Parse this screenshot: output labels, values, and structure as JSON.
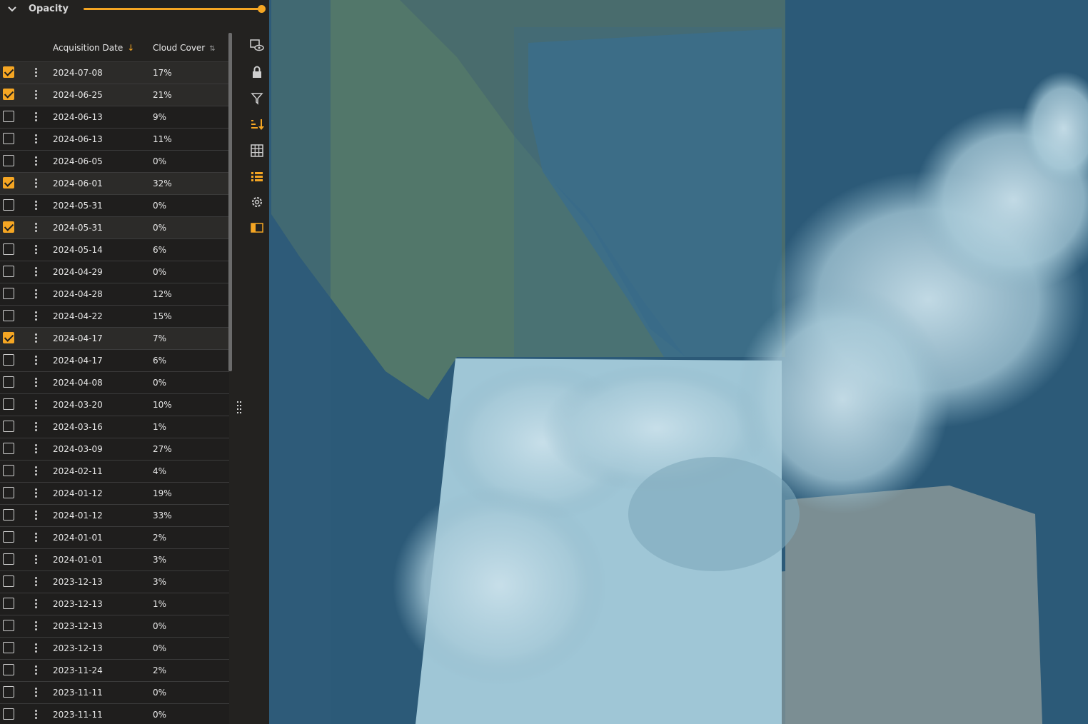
{
  "opacity": {
    "label": "Opacity",
    "value": 1.0
  },
  "table": {
    "columns": {
      "date": "Acquisition Date",
      "cloud": "Cloud Cover"
    },
    "rows": [
      {
        "date": "2024-07-08",
        "cloud": "17%",
        "checked": true
      },
      {
        "date": "2024-06-25",
        "cloud": "21%",
        "checked": true
      },
      {
        "date": "2024-06-13",
        "cloud": "9%",
        "checked": false
      },
      {
        "date": "2024-06-13",
        "cloud": "11%",
        "checked": false
      },
      {
        "date": "2024-06-05",
        "cloud": "0%",
        "checked": false
      },
      {
        "date": "2024-06-01",
        "cloud": "32%",
        "checked": true
      },
      {
        "date": "2024-05-31",
        "cloud": "0%",
        "checked": false
      },
      {
        "date": "2024-05-31",
        "cloud": "0%",
        "checked": true
      },
      {
        "date": "2024-05-14",
        "cloud": "6%",
        "checked": false
      },
      {
        "date": "2024-04-29",
        "cloud": "0%",
        "checked": false
      },
      {
        "date": "2024-04-28",
        "cloud": "12%",
        "checked": false
      },
      {
        "date": "2024-04-22",
        "cloud": "15%",
        "checked": false
      },
      {
        "date": "2024-04-17",
        "cloud": "7%",
        "checked": true
      },
      {
        "date": "2024-04-17",
        "cloud": "6%",
        "checked": false
      },
      {
        "date": "2024-04-08",
        "cloud": "0%",
        "checked": false
      },
      {
        "date": "2024-03-20",
        "cloud": "10%",
        "checked": false
      },
      {
        "date": "2024-03-16",
        "cloud": "1%",
        "checked": false
      },
      {
        "date": "2024-03-09",
        "cloud": "27%",
        "checked": false
      },
      {
        "date": "2024-02-11",
        "cloud": "4%",
        "checked": false
      },
      {
        "date": "2024-01-12",
        "cloud": "19%",
        "checked": false
      },
      {
        "date": "2024-01-12",
        "cloud": "33%",
        "checked": false
      },
      {
        "date": "2024-01-01",
        "cloud": "2%",
        "checked": false
      },
      {
        "date": "2024-01-01",
        "cloud": "3%",
        "checked": false
      },
      {
        "date": "2023-12-13",
        "cloud": "3%",
        "checked": false
      },
      {
        "date": "2023-12-13",
        "cloud": "1%",
        "checked": false
      },
      {
        "date": "2023-12-13",
        "cloud": "0%",
        "checked": false
      },
      {
        "date": "2023-12-13",
        "cloud": "0%",
        "checked": false
      },
      {
        "date": "2023-11-24",
        "cloud": "2%",
        "checked": false
      },
      {
        "date": "2023-11-11",
        "cloud": "0%",
        "checked": false
      },
      {
        "date": "2023-11-11",
        "cloud": "0%",
        "checked": false
      }
    ]
  },
  "toolbar": {
    "items": [
      {
        "icon": "layer-visibility-icon",
        "active": false
      },
      {
        "icon": "lock-icon",
        "active": false
      },
      {
        "icon": "filter-icon",
        "active": false
      },
      {
        "icon": "sort-icon",
        "active": true
      },
      {
        "icon": "grid-icon",
        "active": false
      },
      {
        "icon": "list-icon",
        "active": true
      },
      {
        "icon": "settings-icon",
        "active": false
      },
      {
        "icon": "panel-toggle-icon",
        "active": true
      }
    ]
  },
  "colors": {
    "accent": "#f5a623",
    "panel": "#232220",
    "text": "#e8e8e8"
  }
}
